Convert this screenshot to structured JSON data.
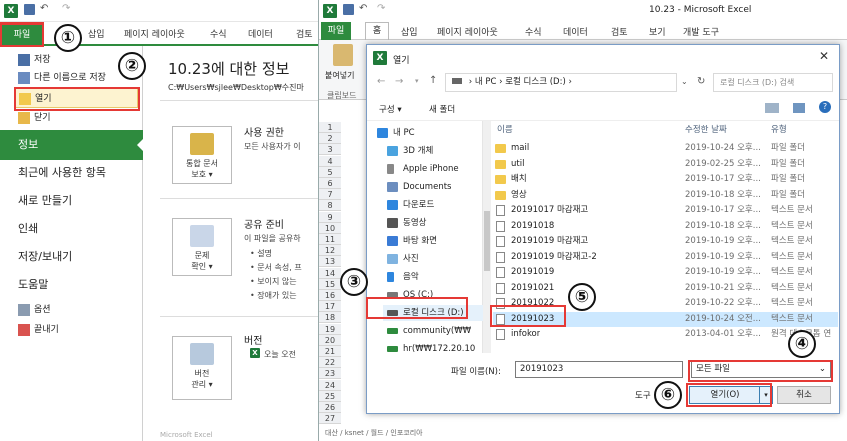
{
  "left_window": {
    "tabs": [
      "파일",
      "삽입",
      "페이지 레이아웃",
      "수식",
      "데이터",
      "검토"
    ],
    "nav_small_top": [
      "저장",
      "다른 이름으로 저장",
      "열기",
      "닫기"
    ],
    "nav_big": [
      "정보",
      "최근에 사용한 항목",
      "새로 만들기",
      "인쇄",
      "저장/보내기",
      "도움말"
    ],
    "nav_small_bottom": [
      "옵션",
      "끝내기"
    ],
    "info": {
      "title": "10.23에 대한 정보",
      "path": "C:₩Users₩sjlee₩Desktop₩수진마",
      "perm": {
        "tile_label": "통합 문서",
        "tile_label2": "보호 ▾",
        "heading": "사용 권한",
        "text": "모든 사용자가 이"
      },
      "share": {
        "tile_label": "문제",
        "tile_label2": "확인 ▾",
        "heading": "공유 준비",
        "text": "이 파일을 공유하",
        "bullets": [
          "설명",
          "문서 속성, 프",
          "보이지 않는",
          "장애가 있는"
        ]
      },
      "version": {
        "tile_label": "버전",
        "tile_label2": "관리 ▾",
        "heading": "버전",
        "text": "오늘 오전"
      }
    },
    "bottom_text": "Microsoft Excel"
  },
  "right_window": {
    "title": "10.23 - Microsoft Excel",
    "tabs": [
      "파일",
      "홈",
      "삽입",
      "페이지 레이아웃",
      "수식",
      "데이터",
      "검토",
      "보기",
      "개발 도구"
    ],
    "paste_label": "붙여넣기",
    "clipboard_label": "클립보드",
    "sheet_rows": [
      "1",
      "2",
      "3",
      "4",
      "5",
      "6",
      "7",
      "8",
      "9",
      "10",
      "11",
      "12",
      "13",
      "14",
      "15",
      "16",
      "17",
      "18",
      "19",
      "20",
      "21",
      "22",
      "23",
      "24",
      "25",
      "26",
      "27"
    ],
    "sheet_tabs": "대산 / ksnet / 월드 / 인포코리아"
  },
  "dialog": {
    "title": "열기",
    "breadcrumb": [
      "내 PC",
      "로컬 디스크 (D:)"
    ],
    "search_placeholder": "로컬 디스크 (D:) 검색",
    "organize": "구성 ▾",
    "new_folder": "새 폴더",
    "nav": [
      "내 PC",
      "3D 개체",
      "Apple iPhone",
      "Documents",
      "다운로드",
      "동영상",
      "바탕 화면",
      "사진",
      "음악",
      "OS (C:)",
      "로컬 디스크 (D:)",
      "community(₩₩",
      "hr(₩₩172.20.10"
    ],
    "columns": [
      "이름",
      "수정한 날짜",
      "유형"
    ],
    "files": [
      {
        "name": "mail",
        "date": "2019-10-24 오후...",
        "type": "파일 폴더",
        "kind": "folder"
      },
      {
        "name": "util",
        "date": "2019-02-25 오후...",
        "type": "파일 폴더",
        "kind": "folder"
      },
      {
        "name": "배치",
        "date": "2019-10-17 오후...",
        "type": "파일 폴더",
        "kind": "folder"
      },
      {
        "name": "영상",
        "date": "2019-10-18 오후...",
        "type": "파일 폴더",
        "kind": "folder"
      },
      {
        "name": "20191017 마감재고",
        "date": "2019-10-17 오후...",
        "type": "텍스트 문서",
        "kind": "doc"
      },
      {
        "name": "20191018",
        "date": "2019-10-18 오후...",
        "type": "텍스트 문서",
        "kind": "doc"
      },
      {
        "name": "20191019 마감재고",
        "date": "2019-10-19 오후...",
        "type": "텍스트 문서",
        "kind": "doc"
      },
      {
        "name": "20191019 마감재고-2",
        "date": "2019-10-19 오후...",
        "type": "텍스트 문서",
        "kind": "doc"
      },
      {
        "name": "20191019",
        "date": "2019-10-19 오후...",
        "type": "텍스트 문서",
        "kind": "doc"
      },
      {
        "name": "20191021",
        "date": "2019-10-21 오후...",
        "type": "텍스트 문서",
        "kind": "doc"
      },
      {
        "name": "20191022",
        "date": "2019-10-22 오후...",
        "type": "텍스트 문서",
        "kind": "doc"
      },
      {
        "name": "20191023",
        "date": "2019-10-24 오전...",
        "type": "텍스트 문서",
        "kind": "doc",
        "selected": true
      },
      {
        "name": "infokor",
        "date": "2013-04-01 오후...",
        "type": "원격 데스크톱 연",
        "kind": "doc"
      }
    ],
    "filename_label": "파일 이름(N):",
    "filename_value": "20191023",
    "filetype_value": "모든 파일",
    "tools_label": "도구",
    "open_button": "열기(O)",
    "cancel_button": "취소"
  },
  "callouts": [
    "①",
    "②",
    "③",
    "④",
    "⑤",
    "⑥"
  ],
  "colors": {
    "excel_green": "#2e8b3e",
    "highlight_red": "#e53935",
    "selection_blue": "#cce8ff"
  }
}
